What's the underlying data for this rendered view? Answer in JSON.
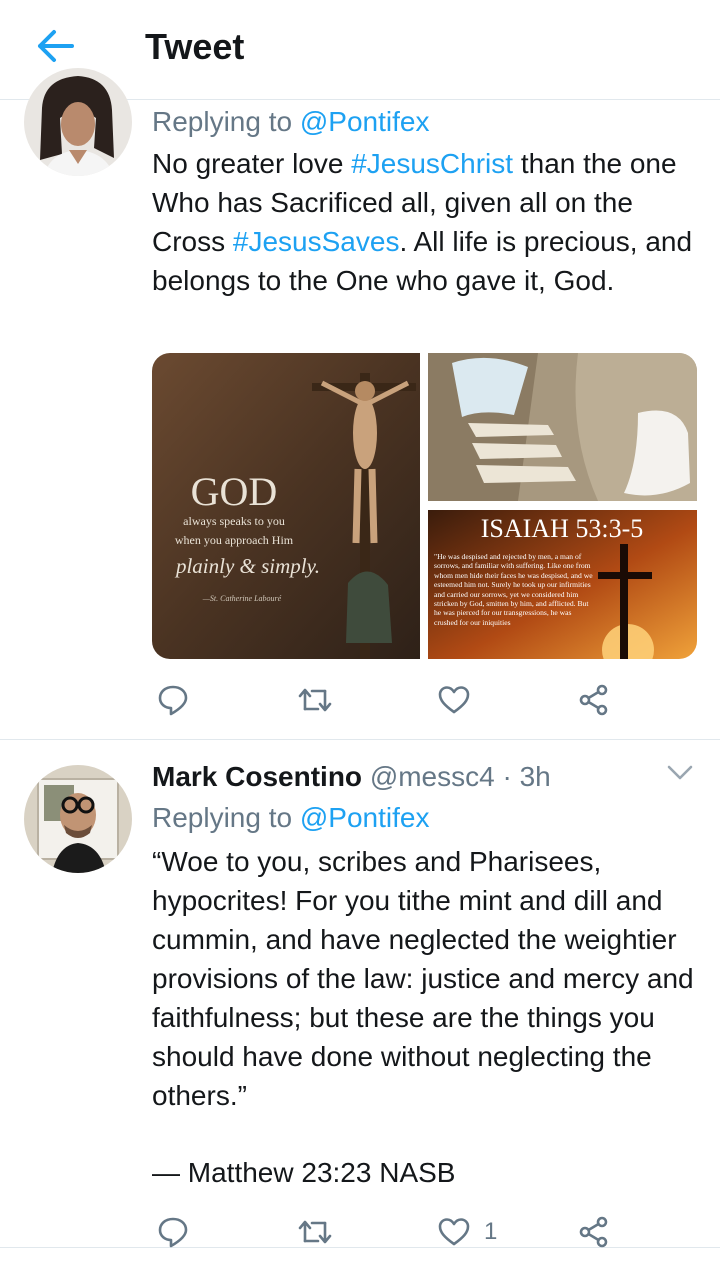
{
  "header": {
    "title": "Tweet",
    "back_icon": "arrow-left-icon",
    "accent": "#1da1f2"
  },
  "tweets": [
    {
      "reply_prefix": "Replying to",
      "reply_handle": "@Pontifex",
      "text_parts": [
        "No greater love ",
        "#JesusChrist",
        " than the one Who has Sacrificed all, given all on the Cross  ",
        "#JesusSaves",
        ". All life is precious, and belongs to the One who gave it, God."
      ],
      "media": {
        "left": {
          "line1": "GOD",
          "line2": "always speaks to you",
          "line3": "when you approach Him",
          "line4": "plainly & simply.",
          "line5": "—St. Catherine Labouré"
        },
        "bottom_right": {
          "title": "ISAIAH 53:3-5",
          "verse": "\"He was despised and rejected by men, a man of sorrows, and familiar with suffering. Like one from whom men hide their faces he was despised, and we esteemed him not. Surely he took up our infirmities and carried our sorrows, yet we considered him stricken by God, smitten by him, and afflicted. But he was pierced for our transgressions, he was crushed for our iniquities"
        }
      },
      "actions": {
        "reply_icon": "reply-icon",
        "retweet_icon": "retweet-icon",
        "like_icon": "heart-icon",
        "share_icon": "share-icon",
        "like_count": ""
      }
    },
    {
      "name": "Mark Cosentino",
      "handle": "@messc4",
      "separator": "·",
      "time": "3h",
      "reply_prefix": "Replying to",
      "reply_handle": "@Pontifex",
      "text": "“Woe to you, scribes and Pharisees, hypocrites! For you tithe mint and dill and cummin, and have neglected the weightier provisions of the law: justice and mercy and faithfulness; but these are the things you should have done without neglecting the others.”",
      "citation": "— Matthew 23:23 NASB",
      "actions": {
        "reply_icon": "reply-icon",
        "retweet_icon": "retweet-icon",
        "like_icon": "heart-icon",
        "share_icon": "share-icon",
        "like_count": "1"
      }
    }
  ]
}
